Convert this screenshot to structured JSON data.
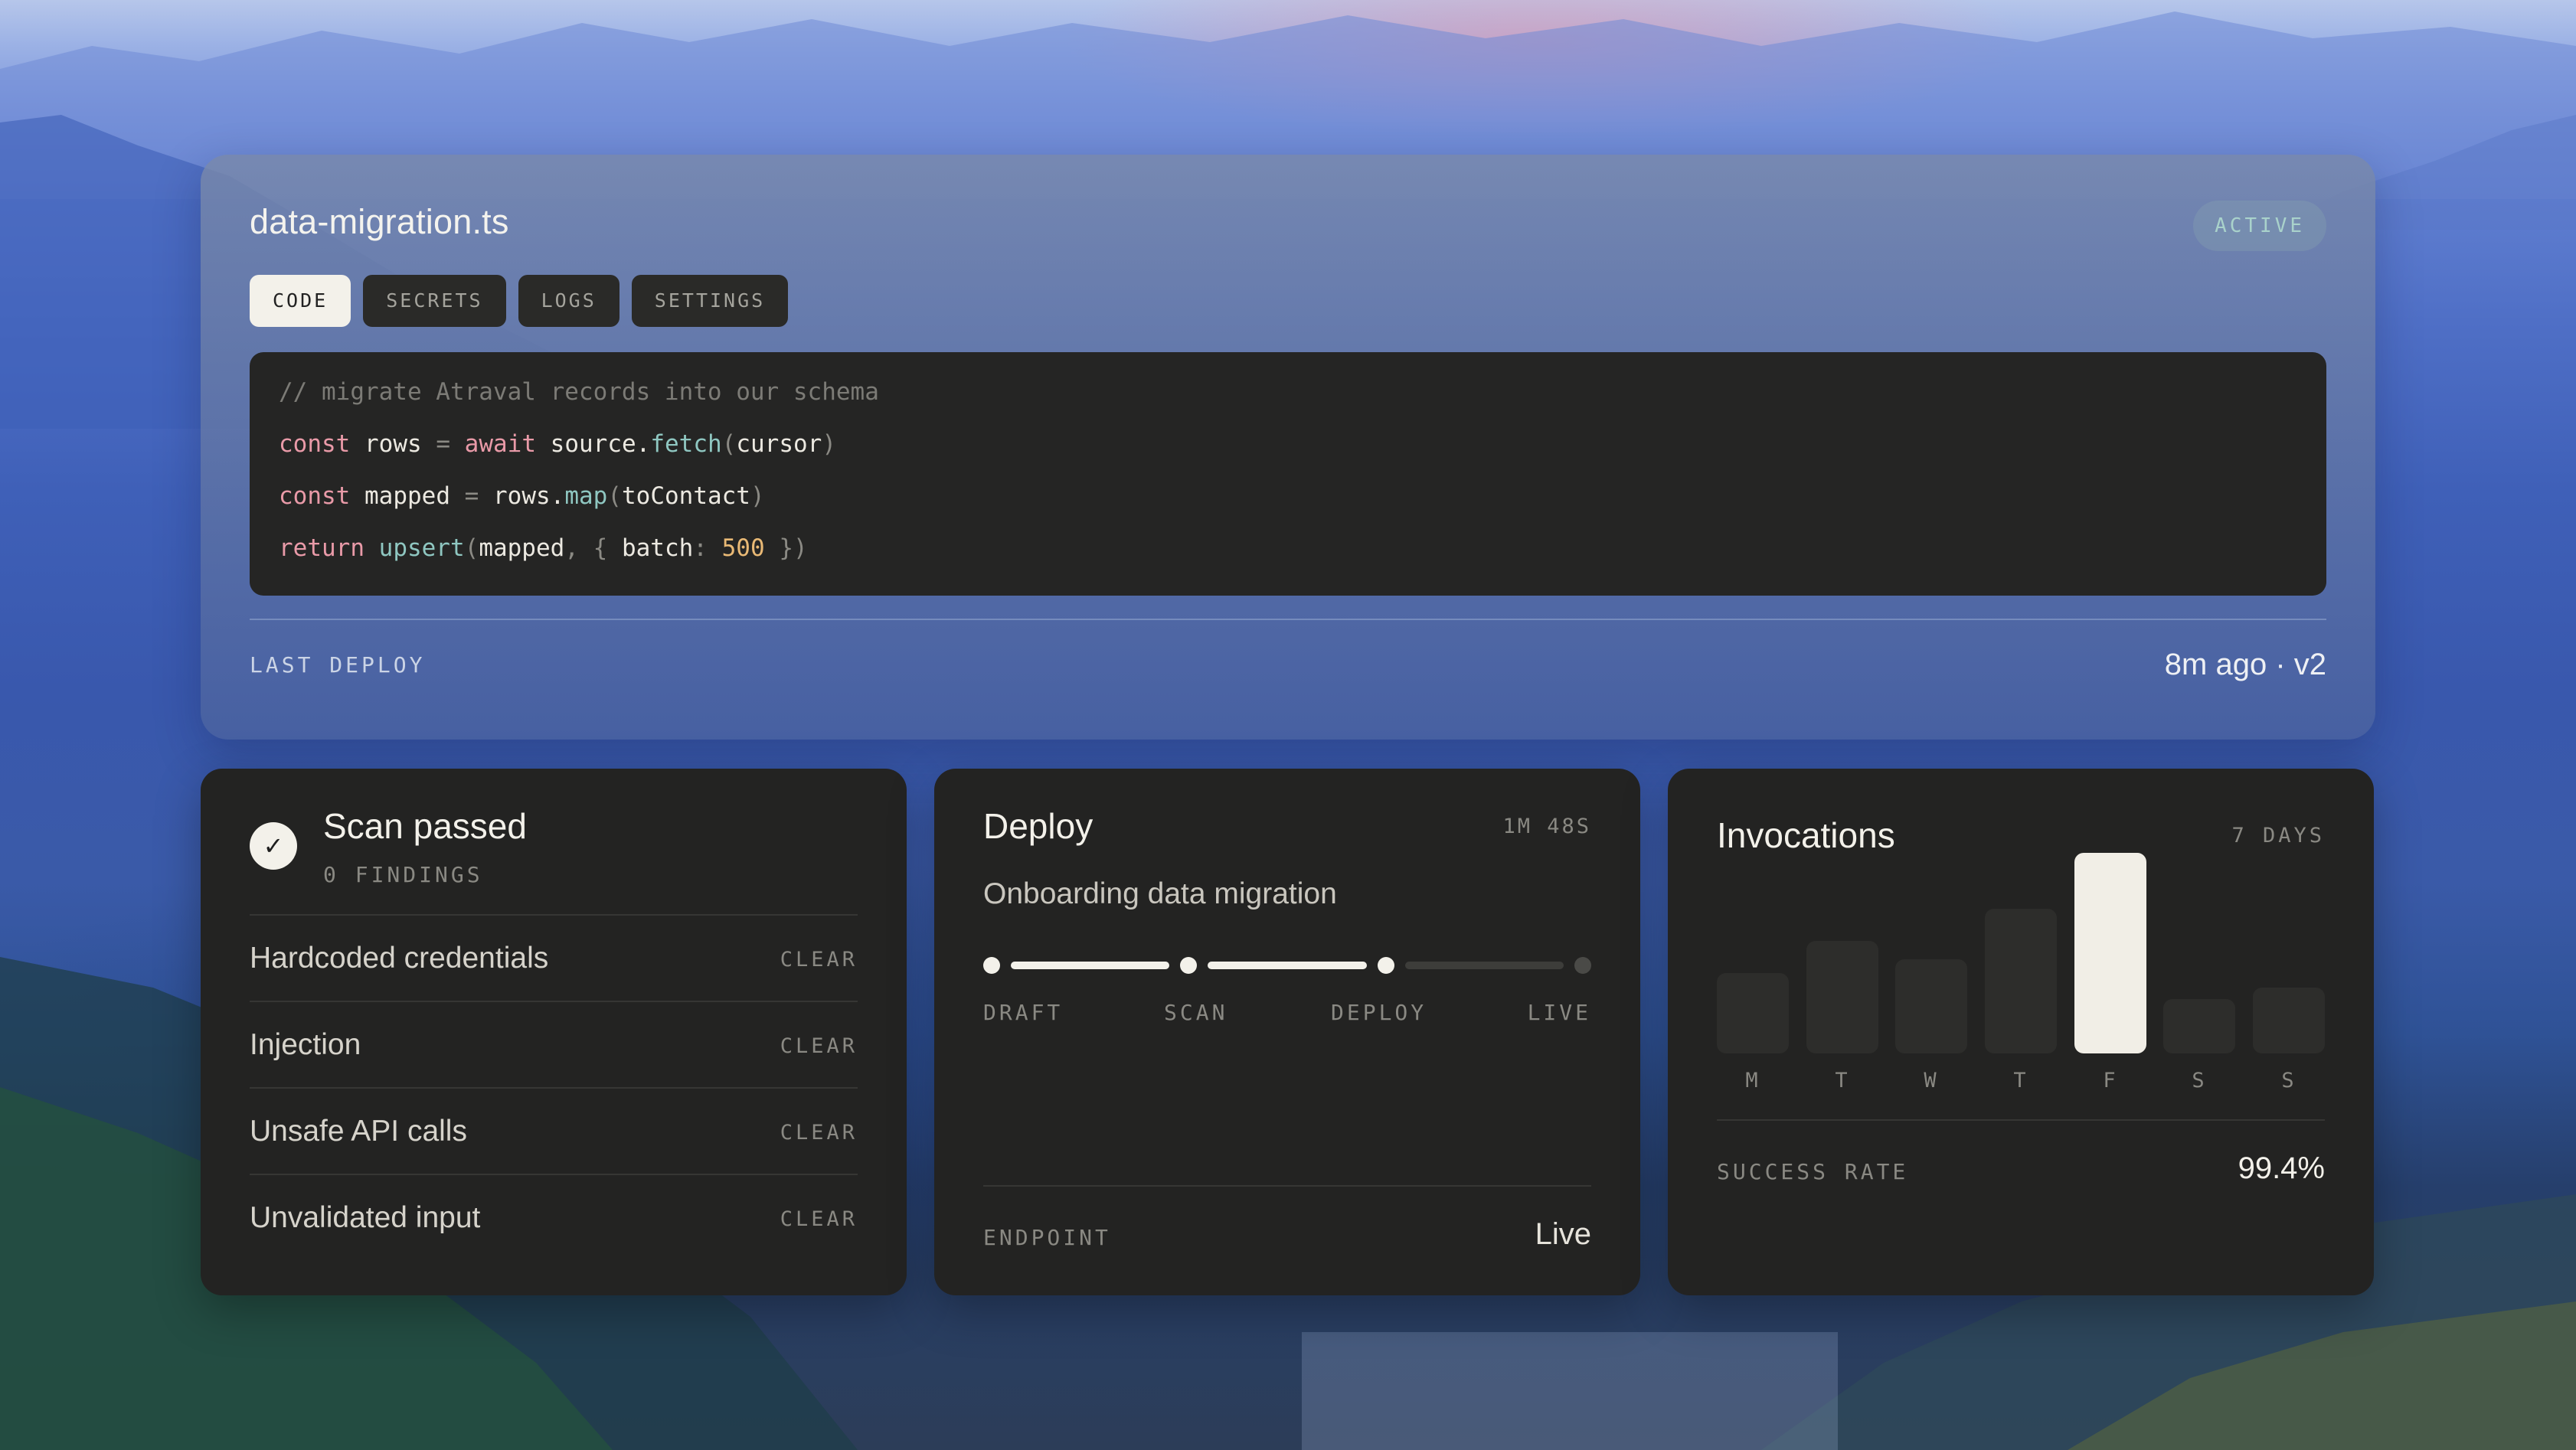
{
  "editor": {
    "filename": "data-migration.ts",
    "status_badge": "ACTIVE",
    "tabs": [
      {
        "label": "CODE",
        "active": true
      },
      {
        "label": "SECRETS",
        "active": false
      },
      {
        "label": "LOGS",
        "active": false
      },
      {
        "label": "SETTINGS",
        "active": false
      }
    ],
    "code": {
      "line1": {
        "comment": "// migrate Atraval records into our schema"
      },
      "line2": {
        "kw": "const",
        "ident": "rows",
        "eq": "=",
        "kw2": "await",
        "obj": "source.",
        "fn": "fetch",
        "open": "(",
        "arg": "cursor",
        "close": ")"
      },
      "line3": {
        "kw": "const",
        "ident": "mapped",
        "eq": "=",
        "obj": "rows.",
        "fn": "map",
        "open": "(",
        "arg": "toContact",
        "close": ")"
      },
      "line4": {
        "kw": "return",
        "fn": "upsert",
        "open": "(",
        "arg": "mapped",
        "sep": ", {",
        "key": "batch",
        "colon": ":",
        "num": "500",
        "close": "})"
      }
    },
    "last_deploy_label": "LAST DEPLOY",
    "last_deploy_value": "8m ago · v2"
  },
  "scan": {
    "title": "Scan passed",
    "findings": "0 FINDINGS",
    "check_icon": "check-icon",
    "items": [
      {
        "label": "Hardcoded credentials",
        "status": "CLEAR"
      },
      {
        "label": "Injection",
        "status": "CLEAR"
      },
      {
        "label": "Unsafe API calls",
        "status": "CLEAR"
      },
      {
        "label": "Unvalidated input",
        "status": "CLEAR"
      }
    ]
  },
  "deploy": {
    "title": "Deploy",
    "duration": "1M 48S",
    "subtitle": "Onboarding data migration",
    "stages": [
      "DRAFT",
      "SCAN",
      "DEPLOY",
      "LIVE"
    ],
    "completed_stages": 3,
    "endpoint_label": "ENDPOINT",
    "endpoint_value": "Live"
  },
  "invocations": {
    "title": "Invocations",
    "range": "7 DAYS",
    "success_label": "SUCCESS RATE",
    "success_value": "99.4%",
    "chart_data": {
      "type": "bar",
      "categories": [
        "M",
        "T",
        "W",
        "T",
        "F",
        "S",
        "S"
      ],
      "values": [
        0.4,
        0.56,
        0.47,
        0.72,
        1.0,
        0.27,
        0.33
      ],
      "highlight_index": 4,
      "colors": {
        "normal": "#2d2d2b",
        "highlight": "#f1eee6"
      }
    }
  }
}
